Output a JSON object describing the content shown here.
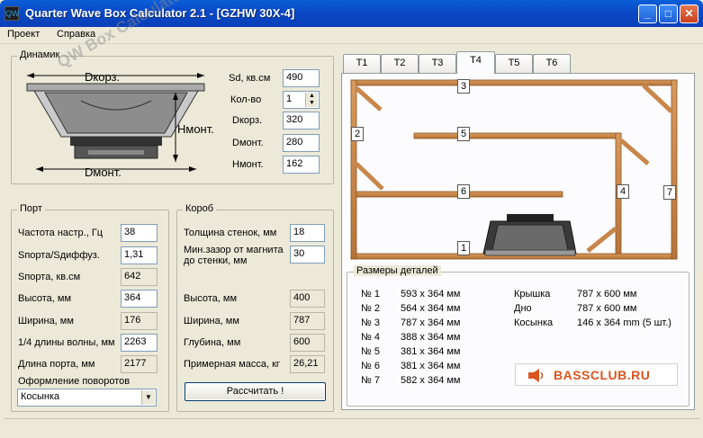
{
  "window": {
    "title": "Quarter Wave Box Calculator 2.1 - [GZHW 30X-4]",
    "icon": "app-logo-icon"
  },
  "menu": [
    "Проект",
    "Справка"
  ],
  "watermark": "QW Box Calculator",
  "speaker": {
    "title": "Динамик",
    "diagram": {
      "top_label": "Dкорз.",
      "side_label": "Hмонт.",
      "bottom_label": "Dмонт."
    },
    "fields": [
      {
        "label": "Sd, кв.см",
        "value": "490"
      },
      {
        "label": "Кол-во",
        "value": "1"
      },
      {
        "label": "Dкорз.",
        "value": "320"
      },
      {
        "label": "Dмонт.",
        "value": "280"
      },
      {
        "label": "Hмонт.",
        "value": "162"
      }
    ]
  },
  "port": {
    "title": "Порт",
    "fields": [
      {
        "label": "Частота настр., Гц",
        "value": "38"
      },
      {
        "label": "Sпорта/Sдиффуз.",
        "value": "1,31"
      },
      {
        "label": "Sпорта, кв.см",
        "value": "642"
      },
      {
        "label": "Высота, мм",
        "value": "364"
      },
      {
        "label": "Ширина, мм",
        "value": "176"
      },
      {
        "label": "1/4 длины волны, мм",
        "value": "2263"
      },
      {
        "label": "Длина порта, мм",
        "value": "2177"
      }
    ],
    "turns_label": "Оформление поворотов",
    "turns_value": "Косынка"
  },
  "box": {
    "title": "Короб",
    "fields": [
      {
        "label": "Толщина стенок, мм",
        "value": "18"
      },
      {
        "label": "Мин.зазор от магнита до стенки, мм",
        "value": "30"
      },
      {
        "label": "Высота, мм",
        "value": "400"
      },
      {
        "label": "Ширина, мм",
        "value": "787"
      },
      {
        "label": "Глубина, мм",
        "value": "600"
      },
      {
        "label": "Примерная масса, кг",
        "value": "26,21"
      }
    ],
    "calc_button": "Рассчитать !"
  },
  "tabs": [
    "T1",
    "T2",
    "T3",
    "T4",
    "T5",
    "T6"
  ],
  "selected_tab": "T4",
  "diagram_labels": [
    "1",
    "2",
    "3",
    "4",
    "5",
    "6",
    "7"
  ],
  "parts": {
    "title": "Размеры деталей",
    "list": [
      {
        "name": "№ 1",
        "size": "593 x 364 мм"
      },
      {
        "name": "№ 2",
        "size": "564 x 364 мм"
      },
      {
        "name": "№ 3",
        "size": "787 x 364 мм"
      },
      {
        "name": "№ 4",
        "size": "388 x 364 мм"
      },
      {
        "name": "№ 5",
        "size": "381 x 364 мм"
      },
      {
        "name": "№ 6",
        "size": "381 x 364 мм"
      },
      {
        "name": "№ 7",
        "size": "582 x 364 мм"
      }
    ],
    "extra": [
      {
        "name": "Крышка",
        "size": "787 x 600 мм"
      },
      {
        "name": "Дно",
        "size": "787 x 600 мм"
      },
      {
        "name": "Косынка",
        "size": "146 x 364 mm (5 шт.)"
      }
    ]
  },
  "logo": {
    "text": "BASSCLUB.RU",
    "icon": "speaker-icon"
  },
  "colors": {
    "titlebar": "#0a4ac8",
    "wood": "#c8864a",
    "logo": "#d9541e"
  }
}
